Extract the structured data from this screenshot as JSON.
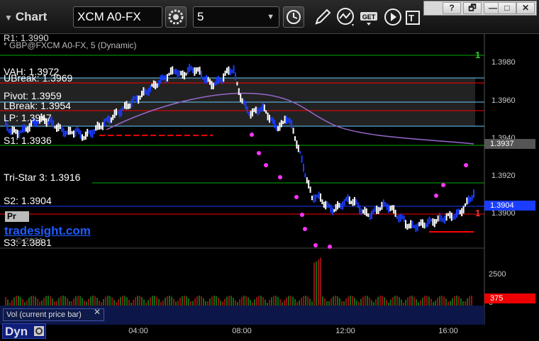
{
  "toolbar": {
    "app_title": "Chart",
    "symbol": "XCM A0-FX",
    "interval": "5",
    "icons": [
      "settings-gear-icon",
      "clock-icon",
      "pencil-icon",
      "indicator-icon",
      "get-data-icon",
      "play-icon",
      "text-tool-icon"
    ],
    "get_label": "GET"
  },
  "window_controls": [
    "?",
    "🗗",
    "—",
    "□",
    "✕"
  ],
  "chart": {
    "r1_label": "R1: 1.3990",
    "series_label": "* GBP@FXCM A0-FX, 5 (Dynamic)",
    "levels": [
      {
        "label": "VAH: 1.3972"
      },
      {
        "label": "UBreak: 1.3969"
      },
      {
        "label": "Pivot: 1.3959"
      },
      {
        "label": "LBreak: 1.3954"
      },
      {
        "label": "LP: 1.3947"
      },
      {
        "label": "S1: 1.3936"
      },
      {
        "label": "Tri-Star 3: 1.3916"
      },
      {
        "label": "S2: 1.3904"
      },
      {
        "label": "S3: 1.3881"
      }
    ],
    "pr_tag": "Pr",
    "watermark": "tradesight.com",
    "copyright": "© 2021",
    "price_axis": [
      "1.3980",
      "1.3960",
      "1.3940",
      "1.3920",
      "1.3900"
    ],
    "current_price": "1.3937",
    "last_price": "1.3904",
    "time_axis": [
      "04:00",
      "08:00",
      "12:00",
      "16:00"
    ],
    "right_numbers": [
      "1",
      "1"
    ],
    "colors": {
      "up_bar": "#ffffff",
      "down_bar": "#1a3dff",
      "ma_line": "#9966cc",
      "red_level": "#ff0000",
      "green_level": "#00aa00",
      "cyan_level": "#66ccff",
      "magenta_count": "#ff33ff"
    }
  },
  "volume": {
    "label": "Vol (current price bar)",
    "close_glyph": "✕",
    "ticks": [
      "2500",
      "0"
    ],
    "current_volume": "375"
  },
  "footer": {
    "dyn_label": "Dyn"
  }
}
